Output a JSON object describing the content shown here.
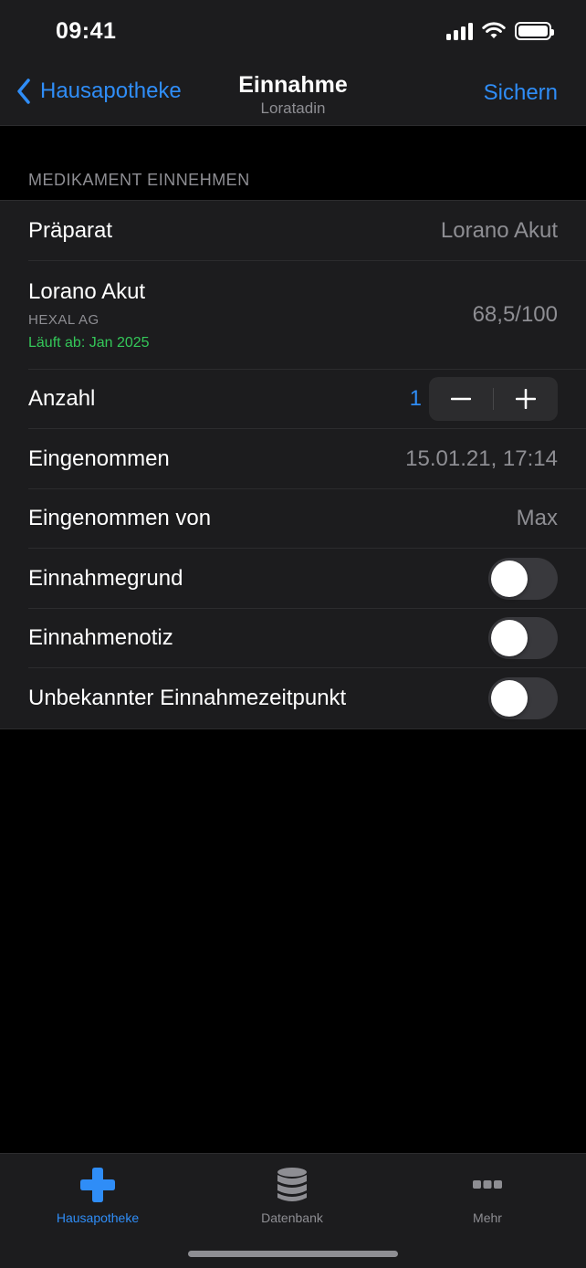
{
  "status_bar": {
    "time": "09:41"
  },
  "nav": {
    "back_label": "Hausapotheke",
    "title": "Einnahme",
    "subtitle": "Loratadin",
    "save_label": "Sichern"
  },
  "section": {
    "header": "MEDIKAMENT EINNEHMEN"
  },
  "rows": {
    "preparation": {
      "label": "Präparat",
      "value": "Lorano Akut"
    },
    "medication": {
      "name": "Lorano Akut",
      "manufacturer": "HEXAL AG",
      "expiry": "Läuft ab: Jan 2025",
      "stock": "68,5/100"
    },
    "quantity": {
      "label": "Anzahl",
      "value": "1"
    },
    "taken_at": {
      "label": "Eingenommen",
      "value": "15.01.21, 17:14"
    },
    "taken_by": {
      "label": "Eingenommen von",
      "value": "Max"
    },
    "reason": {
      "label": "Einnahmegrund",
      "enabled": false
    },
    "note": {
      "label": "Einnahmenotiz",
      "enabled": false
    },
    "unknown_time": {
      "label": "Unbekannter Einnahmezeitpunkt",
      "enabled": false
    }
  },
  "tabbar": {
    "items": [
      {
        "label": "Hausapotheke",
        "icon": "medical-cross-icon",
        "active": true
      },
      {
        "label": "Datenbank",
        "icon": "database-icon",
        "active": false
      },
      {
        "label": "Mehr",
        "icon": "more-icon",
        "active": false
      }
    ]
  },
  "colors": {
    "accent": "#2f8df7",
    "expiry": "#34c759",
    "background": "#000000",
    "surface": "#1c1c1e"
  }
}
